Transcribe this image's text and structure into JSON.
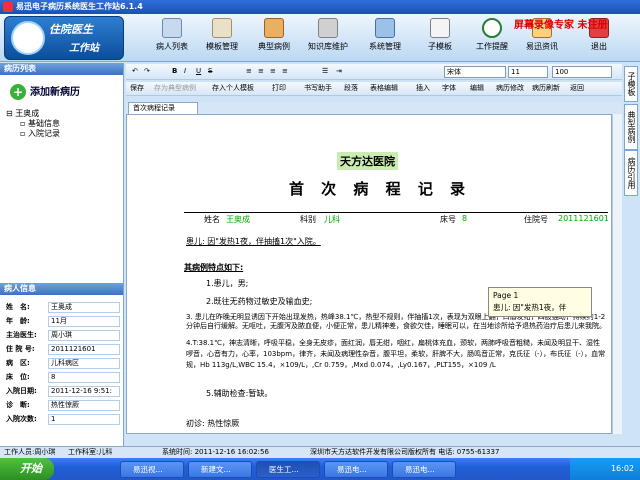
{
  "app": {
    "title": "易迅电子病历系统医生工作站6.1.4"
  },
  "logo": {
    "line1": "住院医生",
    "line2": "工作站"
  },
  "ribbon": {
    "buttons": [
      "病人列表",
      "模板管理",
      "典型病例",
      "知识库维护",
      "系统管理",
      "子模板",
      "工作提醒",
      "易迅资讯",
      "退出"
    ]
  },
  "brand": "屏幕录像专家 未注册",
  "left": {
    "header": "病历列表",
    "add": "添加新病历",
    "tree": [
      "王奥成",
      "基础信息",
      "入院记录"
    ]
  },
  "patient": {
    "header": "病人信息",
    "rows": [
      {
        "k": "姓　名:",
        "v": "王奥成"
      },
      {
        "k": "年　龄:",
        "v": "11月"
      },
      {
        "k": "主治医生:",
        "v": "周小琪"
      },
      {
        "k": "住 院 号:",
        "v": "2011121601"
      },
      {
        "k": "病　区:",
        "v": "儿科病区"
      },
      {
        "k": "床　位:",
        "v": "8"
      },
      {
        "k": "入院日期:",
        "v": "2011-12-16 9:51:"
      },
      {
        "k": "诊　断:",
        "v": "热性惊厥"
      },
      {
        "k": "入院次数:",
        "v": "1"
      }
    ]
  },
  "toolbar1": {
    "font": "宋体",
    "size": "11",
    "zoom": "100"
  },
  "toolbar2": [
    "保存",
    "存为典型病例",
    "存入个人模板",
    "打印",
    "书写助手",
    "段落",
    "表格编辑",
    "插入",
    "字体",
    "编辑",
    "病历修改",
    "病历刷新",
    "返回"
  ],
  "tab": "首次病程记录",
  "document": {
    "hospital": "天方达医院",
    "title": "首 次 病 程 记 录",
    "hdr": {
      "name_k": "姓名",
      "name_v": "王奥成",
      "dept_k": "科别",
      "dept_v": "儿科",
      "bed_k": "床号",
      "bed_v": "8",
      "adm_k": "住院号",
      "adm_v": "2011121601"
    },
    "complaint": "患儿: 因\"发热1夜，伴抽搐1次\"入院。",
    "section": "其病例特点如下:",
    "items": [
      "1.患儿，男;",
      "2.既往无药物过敏史及输血史;",
      "3. 患儿在昨晚无明显诱因下开始出现发热，热峰38.1℃，热型不规则，伴抽搐1次，表现为双眼上翻，口唇发绀，四肢抽动，持续约1-2分钟后自行缓解。无呕吐，无腹泻及脓血便，小便正常，患儿精神差，食欲欠佳，睡眠可以，在当地诊所给予退热药治疗后患儿来我院。",
      "4.T:38.1℃，神志清晰，呼吸平稳，全身无皮疹，面红润，唇无绀，咽红，扁桃体充血，颈软，两肺呼吸音粗糙，未闻及明显干、湿性啰音，心音有力，心率，103bpm，律齐，未闻及病理性杂音，腹平坦，柔软，肝脾不大，肠鸣音正常，克氏征（-），布氏征（-），血常规，Hb 113g/L,WBC 15.4，×109/L，,Cr 0.759，,Mxd 0.074，,Ly0.167，,PLT155，×109 /L",
      "5.辅助检查:暂缺。"
    ],
    "diag": "初诊: 热性惊厥"
  },
  "tooltip": {
    "line1": "Page 1",
    "line2": "患儿: 因\"发热1夜，伴"
  },
  "vtabs": [
    "子模板",
    "典型病例",
    "病历引用"
  ],
  "status": {
    "user": "工作人员:周小琪",
    "dept": "工作科室:儿科",
    "time": "系统时间: 2011-12-16 16:02:56",
    "company": "深圳市天方达软件开发有限公司版权所有  电话: 0755-61337"
  },
  "taskbar": {
    "start": "开始",
    "tasks": [
      "易迅视...",
      "新建文...",
      "医生工...",
      "易迅电...",
      "易迅电..."
    ],
    "clock": "16:02"
  }
}
